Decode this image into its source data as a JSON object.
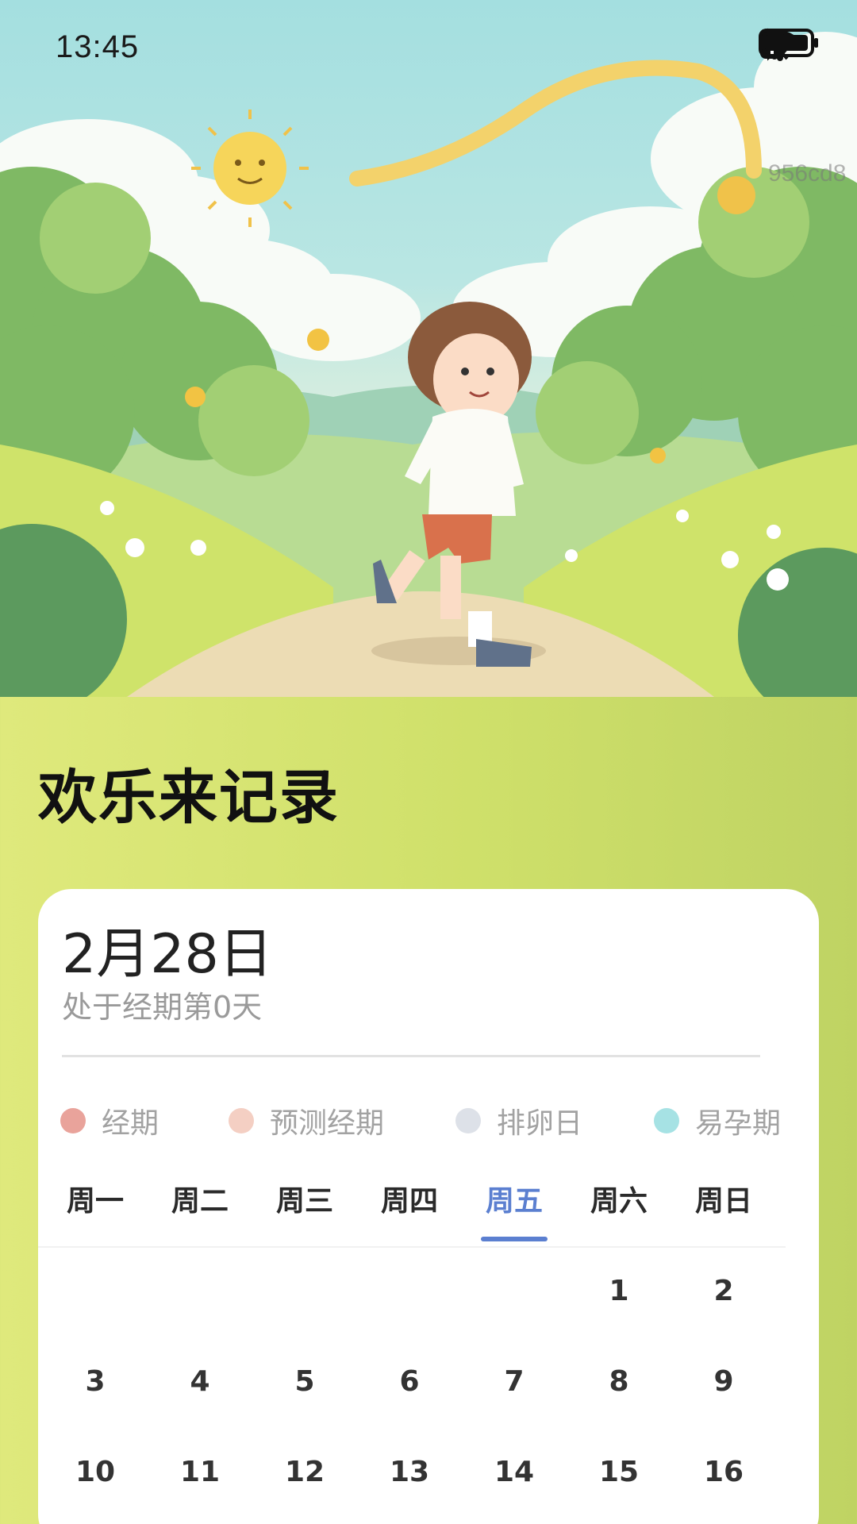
{
  "status_bar": {
    "time": "13:45",
    "icons": [
      "bluetooth-icon",
      "mute-icon",
      "wifi-icon",
      "alert-icon",
      "battery-icon"
    ]
  },
  "watermark": "956cd8",
  "title": "欢乐来记录",
  "card": {
    "date": "2月28日",
    "status": "处于经期第0天",
    "legend": [
      {
        "label": "经期",
        "color": "#e9a39b"
      },
      {
        "label": "预测经期",
        "color": "#f4cfc3"
      },
      {
        "label": "排卵日",
        "color": "#dde1e8"
      },
      {
        "label": "易孕期",
        "color": "#a6e2e4"
      }
    ],
    "weekdays": [
      "周一",
      "周二",
      "周三",
      "周四",
      "周五",
      "周六",
      "周日"
    ],
    "active_weekday": "周五",
    "weeks": [
      [
        "",
        "",
        "",
        "",
        "",
        "1",
        "2"
      ],
      [
        "3",
        "4",
        "5",
        "6",
        "7",
        "8",
        "9"
      ],
      [
        "10",
        "11",
        "12",
        "13",
        "14",
        "15",
        "16"
      ]
    ]
  },
  "colors": {
    "accent": "#5b7fd0",
    "background_left": "#dfe97c",
    "background_right": "#bfd363"
  }
}
